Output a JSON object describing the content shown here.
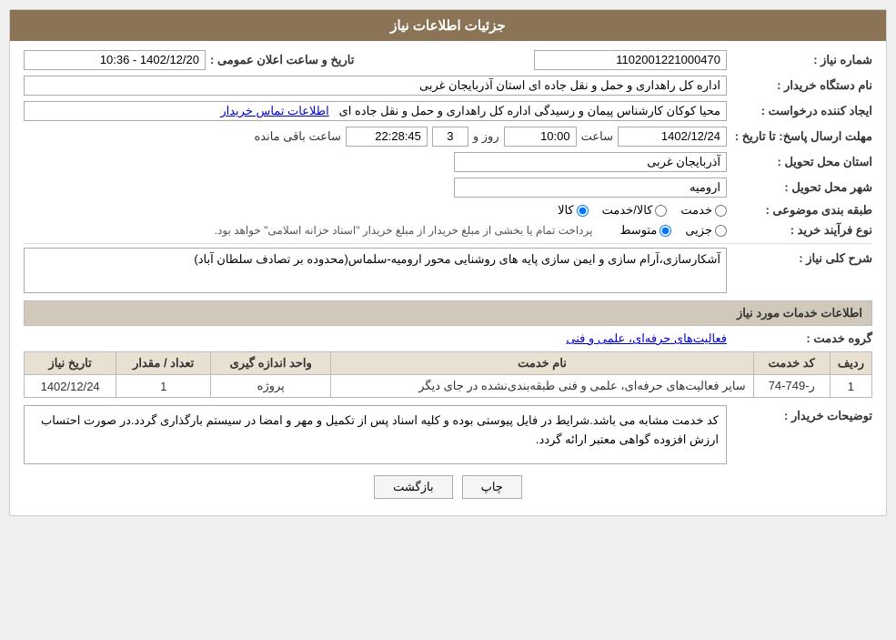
{
  "header": {
    "title": "جزئیات اطلاعات نیاز"
  },
  "fields": {
    "shomara_niaz_label": "شماره نیاز :",
    "shomara_niaz_value": "1102001221000470",
    "nam_dastgah_label": "نام دستگاه خریدار :",
    "nam_dastgah_value": "اداره کل راهداری و حمل و نقل جاده ای استان آذربایجان غربی",
    "ijad_label": "ایجاد کننده درخواست :",
    "ijad_value": "محیا کوکان کارشناس پیمان و رسیدگی اداره کل راهداری و حمل و نقل جاده ای",
    "ijad_link": "اطلاعات تماس خریدار",
    "mohlat_label": "مهلت ارسال پاسخ: تا تاریخ :",
    "mohlat_date": "1402/12/24",
    "mohlat_saat_label": "ساعت",
    "mohlat_saat_value": "10:00",
    "mohlat_roz_label": "روز و",
    "mohlat_roz_value": "3",
    "mohlat_baqi_label": "ساعت باقی مانده",
    "mohlat_baqi_value": "22:28:45",
    "ostan_label": "استان محل تحویل :",
    "ostan_value": "آذربایجان غربی",
    "shahr_label": "شهر محل تحویل :",
    "shahr_value": "ارومیه",
    "tabaqe_label": "طبقه بندی موضوعی :",
    "tabaqe_options": [
      "خدمت",
      "کالا/خدمت",
      "کالا"
    ],
    "tabaqe_selected": "کالا",
    "noع_farayand_label": "نوع فرآیند خرید :",
    "noع_farayand_options": [
      "جزیی",
      "متوسط"
    ],
    "noع_farayand_selected": "متوسط",
    "noع_farayand_note": "پرداخت تمام یا بخشی از مبلغ خریدار از مبلغ خریدار \"اسناد خزانه اسلامی\" خواهد بود.",
    "sharh_label": "شرح کلی نیاز :",
    "sharh_value": "آشکارسازی،آرام سازی و ایمن سازی پایه های روشنایی محور ارومیه-سلماس(محدوده بر تصادف سلطان آباد)",
    "section2_title": "اطلاعات خدمات مورد نیاز",
    "goroh_label": "گروه خدمت :",
    "goroh_value": "فعالیت‌های حرفه‌ای، علمی و فنی",
    "table": {
      "headers": [
        "ردیف",
        "کد خدمت",
        "نام خدمت",
        "واحد اندازه گیری",
        "تعداد / مقدار",
        "تاریخ نیاز"
      ],
      "rows": [
        {
          "radif": "1",
          "code": "ر-749-74",
          "name": "سایر فعالیت‌های حرفه‌ای، علمی و فنی طبقه‌بندی‌نشده در جای دیگر",
          "unit": "پروژه",
          "tedad": "1",
          "tarikh": "1402/12/24"
        }
      ]
    },
    "towzih_label": "توضیحات خریدار :",
    "towzih_value": "کد خدمت مشابه می باشد.شرایط در فایل پیوستی بوده و کلیه اسناد پس از تکمیل و مهر و امضا در سیستم بارگذاری گردد.در صورت احتساب ارزش افزوده گواهی معتبر ارائه گردد.",
    "tarikh_label": "تاریخ و ساعت اعلان عمومی :",
    "tarikh_value": "1402/12/20 - 10:36",
    "buttons": {
      "print_label": "چاپ",
      "back_label": "بازگشت"
    }
  }
}
